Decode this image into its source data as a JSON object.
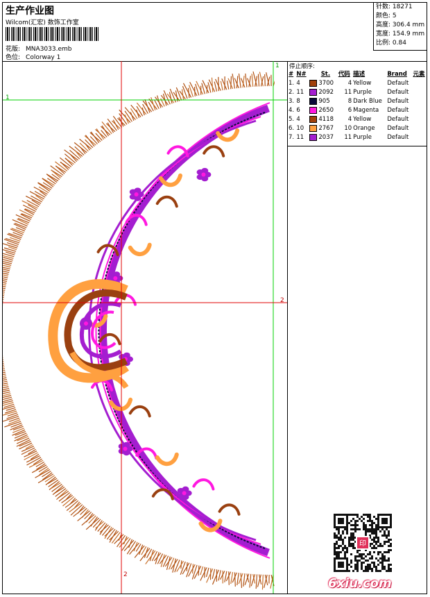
{
  "header": {
    "title": "生产作业图",
    "company": "Wilcom(汇宏) 数饰工作室",
    "design_label": "花版:",
    "design_value": "MNA3033.emb",
    "colorway_label": "色位:",
    "colorway_value": "Colorway 1"
  },
  "stats": [
    {
      "label": "针数:",
      "value": "18271"
    },
    {
      "label": "颜色:",
      "value": "5"
    },
    {
      "label": "高度:",
      "value": "306.4 mm"
    },
    {
      "label": "宽度:",
      "value": "154.9 mm"
    },
    {
      "label": "比例:",
      "value": "0.84"
    }
  ],
  "panel": {
    "title": "停止顺序:",
    "headers": [
      "#",
      "N#",
      "St.",
      "代码",
      "描述",
      "Brand",
      "元素"
    ],
    "rows": [
      {
        "idx": "1.",
        "n": "4",
        "st": "3700",
        "code": "4",
        "desc": "Yellow",
        "brand": "Default",
        "color": "#a0400a"
      },
      {
        "idx": "2.",
        "n": "11",
        "st": "2092",
        "code": "11",
        "desc": "Purple",
        "brand": "Default",
        "color": "#a41ed0"
      },
      {
        "idx": "3.",
        "n": "8",
        "st": "905",
        "code": "8",
        "desc": "Dark Blue",
        "brand": "Default",
        "color": "#0a0a3a"
      },
      {
        "idx": "4.",
        "n": "6",
        "st": "2650",
        "code": "6",
        "desc": "Magenta",
        "brand": "Default",
        "color": "#ff18e0"
      },
      {
        "idx": "5.",
        "n": "4",
        "st": "4118",
        "code": "4",
        "desc": "Yellow",
        "brand": "Default",
        "color": "#a0400a"
      },
      {
        "idx": "6.",
        "n": "10",
        "st": "2767",
        "code": "10",
        "desc": "Orange",
        "brand": "Default",
        "color": "#ffa040"
      },
      {
        "idx": "7.",
        "n": "11",
        "st": "2037",
        "code": "11",
        "desc": "Purple",
        "brand": "Default",
        "color": "#a41ed0"
      }
    ]
  },
  "guides": {
    "v1": "1",
    "v2": "2",
    "h1": "1",
    "h2": "2"
  },
  "watermark": {
    "main": "6xiu",
    "tld": ".com",
    "seal": "印"
  },
  "colors": {
    "guide_red": "#e00000",
    "guide_green": "#00d000",
    "fringe": "#b05010",
    "purple": "#a41ed0",
    "magenta": "#ff18e0",
    "orange": "#ffa040",
    "brown": "#9a4010",
    "dark_blue": "#0a0a3a"
  }
}
